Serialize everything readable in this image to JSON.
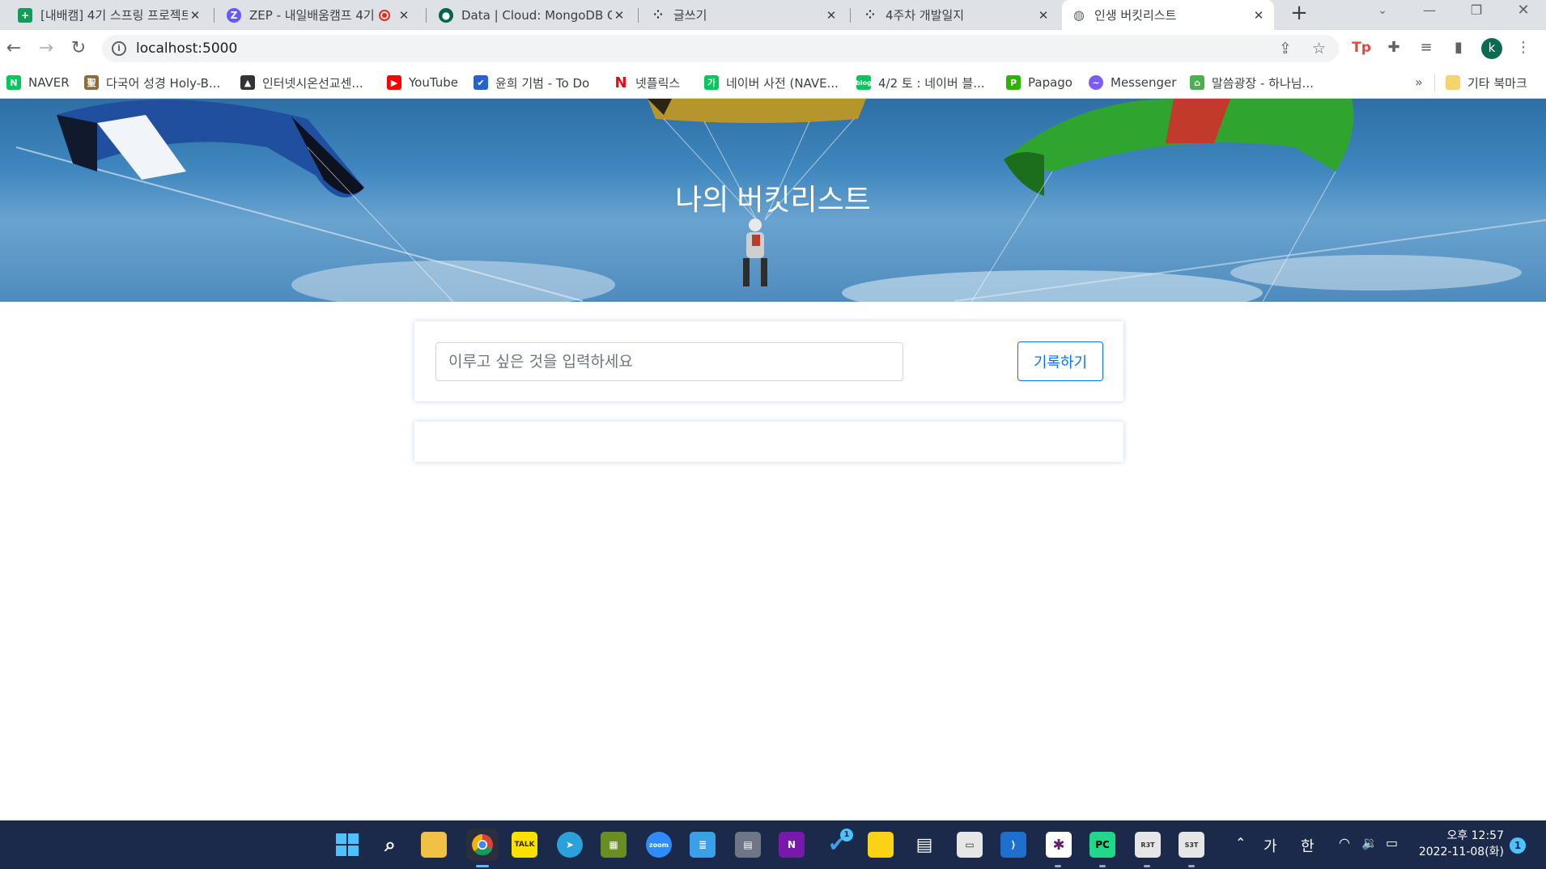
{
  "browser": {
    "tabs": [
      {
        "title": "[내배캠] 4기 스프링 프로젝트",
        "icon": "sheets-icon",
        "color": "#0f9d58"
      },
      {
        "title": "ZEP - 내일배움캠프 4기",
        "icon": "zep-icon",
        "color": "#6758ff"
      },
      {
        "title": "Data | Cloud: MongoDB Cloud",
        "icon": "mongodb-icon",
        "color": "#00684a"
      },
      {
        "title": "글쓰기",
        "icon": "velog-icon",
        "color": "#202124"
      },
      {
        "title": "4주차 개발일지",
        "icon": "velog-icon",
        "color": "#202124"
      },
      {
        "title": "인생 버킷리스트",
        "icon": "globe-icon",
        "color": "#5f6368"
      }
    ],
    "url": "localhost:5000",
    "avatar_initial": "k",
    "bookmarks": [
      {
        "label": "NAVER",
        "icon": "naver-icon",
        "color": "#03c75a"
      },
      {
        "label": "다국어 성경 Holy-B...",
        "icon": "bible-icon",
        "color": "#8a6d3b"
      },
      {
        "label": "인터넷시온선교센...",
        "icon": "graduation-cap-icon",
        "color": "#333333"
      },
      {
        "label": "YouTube",
        "icon": "youtube-icon",
        "color": "#ff0000"
      },
      {
        "label": "윤희 기범 - To Do",
        "icon": "todo-check-icon",
        "color": "#2564cf"
      },
      {
        "label": "넷플릭스",
        "icon": "netflix-icon",
        "color": "#e50914"
      },
      {
        "label": "네이버 사전 (NAVE...",
        "icon": "naver-dict-icon",
        "color": "#03c75a"
      },
      {
        "label": "4/2 토 : 네이버 블...",
        "icon": "naver-blog-icon",
        "color": "#03c75a"
      },
      {
        "label": "Papago",
        "icon": "papago-icon",
        "color": "#2db400"
      },
      {
        "label": "Messenger",
        "icon": "messenger-icon",
        "color": "#7b5cfa"
      },
      {
        "label": "말씀광장 - 하나님...",
        "icon": "church-icon",
        "color": "#4caf50"
      }
    ],
    "other_bookmarks": "기타 북마크"
  },
  "page": {
    "hero_title": "나의 버킷리스트",
    "input_placeholder": "이루고 싶은 것을 입력하세요",
    "input_value": "",
    "record_button": "기록하기"
  },
  "taskbar": {
    "badge_count": "1",
    "ime_mode": "가",
    "ime_lang": "한",
    "time_line1": "오후 12:57",
    "time_line2": "2022-11-08(화)",
    "notification_count": "1"
  }
}
